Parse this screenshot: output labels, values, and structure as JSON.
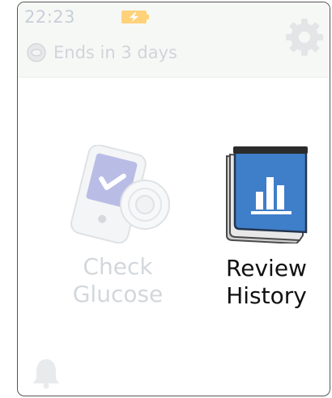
{
  "status_bar": {
    "time": "22:23",
    "battery_icon": "battery-charging-icon",
    "sensor_icon": "sensor-icon",
    "sensor_status": "Ends in 3 days",
    "settings_icon": "gear-icon"
  },
  "main": {
    "check_glucose": {
      "label_line1": "Check",
      "label_line2": "Glucose",
      "icon": "reader-sensor-icon",
      "enabled": false
    },
    "review_history": {
      "label_line1": "Review",
      "label_line2": "History",
      "icon": "history-notebook-icon",
      "enabled": true
    }
  },
  "footer": {
    "alarm_icon": "bell-icon"
  },
  "colors": {
    "accent_blue": "#3f7ec9",
    "disabled_text": "#d3d7db",
    "active_text": "#111111"
  }
}
